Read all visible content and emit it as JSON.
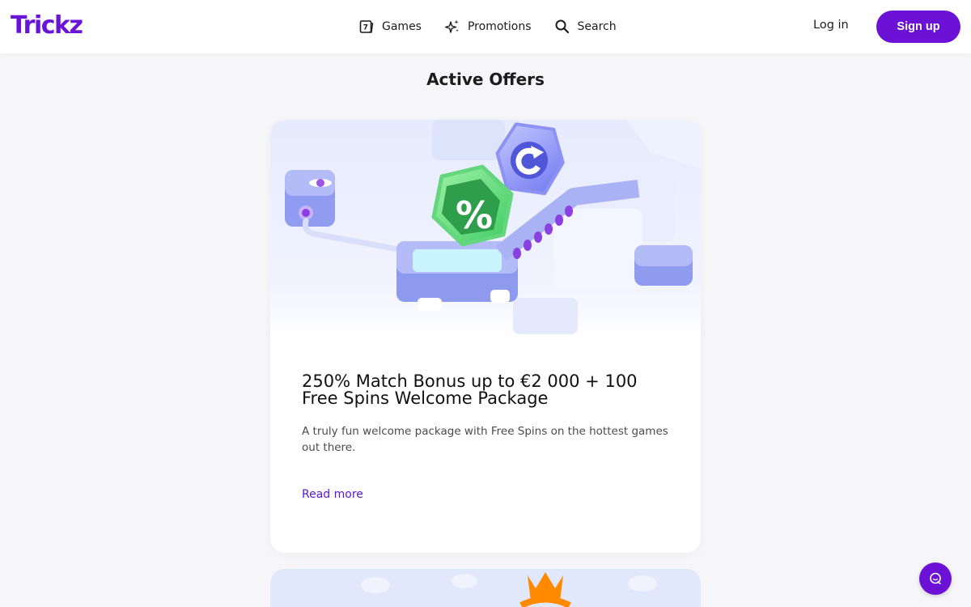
{
  "brand": {
    "name": "Trickz",
    "accent": "#6b12d6"
  },
  "nav": {
    "games": {
      "label": "Games",
      "icon": "games-icon"
    },
    "promotions": {
      "label": "Promotions",
      "icon": "sparkle-icon"
    },
    "search": {
      "label": "Search",
      "icon": "search-icon"
    }
  },
  "auth": {
    "login_label": "Log in",
    "signup_label": "Sign up"
  },
  "page": {
    "title": "Active Offers"
  },
  "offers": [
    {
      "title": "250% Match Bonus up to €2 000 + 100 Free Spins Welcome Package",
      "description": "A truly fun welcome package with Free Spins on the hottest games out there.",
      "link_label": "Read more"
    }
  ],
  "chat": {
    "icon": "chat-icon"
  }
}
